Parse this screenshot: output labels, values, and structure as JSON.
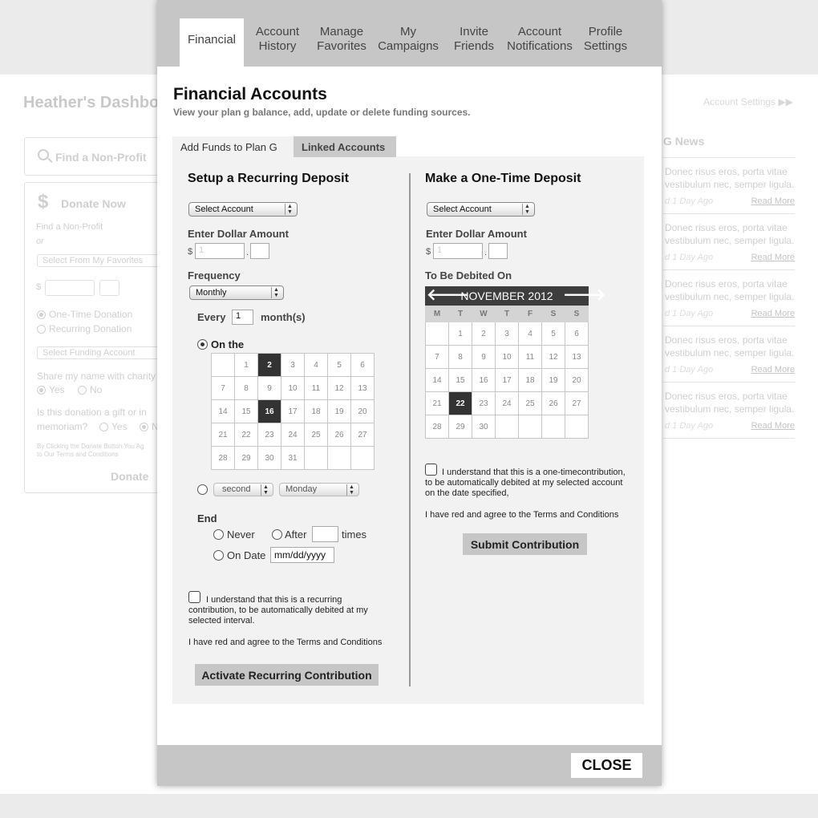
{
  "background": {
    "dashboard_title": "Heather's Dashbo",
    "find_nonprofit": "Find a Non-Profit",
    "donate_now": "Donate Now",
    "find_nonprofit_link": "Find a Non-Profit",
    "or": "or",
    "select_favorites": "Select From My Favorites",
    "dollar_sign": "$",
    "one_time_donation": "One-Time Donation",
    "recurring_donation": "Recurring Donation",
    "select_funding": "Select Funding Account",
    "share_name": "Share my name with charity",
    "yes": "Yes",
    "no": "No",
    "gift_question_1": "Is this donation a gift or in",
    "gift_question_2": "memoriam?",
    "gift_yes": "Yes",
    "gift_n": "N",
    "fine_print_1": "By Clicking the Donate Button You Ag",
    "fine_print_2": "to Our Terms and Conditions",
    "donate_button": "Donate",
    "account_settings": "Account Settings",
    "news_title": "G News",
    "news_items": [
      {
        "text": "Donec risus eros, porta vitae vestibulum nec, semper ligula.",
        "meta": "d 1 Day Ago",
        "read_more": "Read More"
      },
      {
        "text": "Donec risus eros, porta vitae vestibulum nec, semper ligula.",
        "meta": "d 1 Day Ago",
        "read_more": "Read More"
      },
      {
        "text": "Donec risus eros, porta vitae vestibulum nec, semper ligula.",
        "meta": "d 1 Day Ago",
        "read_more": "Read More"
      },
      {
        "text": "Donec risus eros, porta vitae vestibulum nec, semper ligula.",
        "meta": "d 1 Day Ago",
        "read_more": "Read More"
      },
      {
        "text": "Donec risus eros, porta vitae vestibulum nec, semper ligula.",
        "meta": "d 1 Day Ago",
        "read_more": "Read More"
      }
    ]
  },
  "modal": {
    "tabs": [
      {
        "line1": "Financial",
        "line2": ""
      },
      {
        "line1": "Account",
        "line2": "History"
      },
      {
        "line1": "Manage",
        "line2": "Favorites"
      },
      {
        "line1": "My",
        "line2": "Campaigns"
      },
      {
        "line1": "Invite",
        "line2": "Friends"
      },
      {
        "line1": "Account",
        "line2": "Notifications"
      },
      {
        "line1": "Profile",
        "line2": "Settings"
      }
    ],
    "title": "Financial Accounts",
    "subtitle": "View your plan g balance, add, update or delete funding sources.",
    "subtabs": [
      "Add Funds to Plan G",
      "Linked Accounts"
    ],
    "close": "CLOSE"
  },
  "recurring": {
    "heading": "Setup a Recurring Deposit",
    "select_account": "Select Account",
    "enter_amount": "Enter Dollar Amount",
    "dollar_sign": "$",
    "decimal": ".",
    "amount_placeholder": "1",
    "frequency_label": "Frequency",
    "frequency_value": "Monthly",
    "every": "Every",
    "every_value": "1",
    "months": "month(s)",
    "on_the": "On the",
    "day_grid": [
      [
        "",
        "1",
        "2",
        "3",
        "4",
        "5",
        "6"
      ],
      [
        "7",
        "8",
        "9",
        "10",
        "11",
        "12",
        "13"
      ],
      [
        "14",
        "15",
        "16",
        "17",
        "18",
        "19",
        "20"
      ],
      [
        "21",
        "22",
        "23",
        "24",
        "25",
        "26",
        "27"
      ],
      [
        "28",
        "29",
        "30",
        "31",
        "",
        "",
        ""
      ]
    ],
    "selected_days": [
      "2",
      "16"
    ],
    "ordinal_value": "second",
    "weekday_value": "Monday",
    "end_label": "End",
    "never": "Never",
    "after": "After",
    "times": "times",
    "on_date": "On Date",
    "date_placeholder": "mm/dd/yyyy",
    "agree_1": "I understand that this is a recurring",
    "agree_2": "contribution, to be automatically debited at my",
    "agree_3": "selected interval.",
    "terms": "I have red and agree to the Terms and Conditions",
    "button": "Activate Recurring Contribution"
  },
  "one_time": {
    "heading": "Make a One-Time Deposit",
    "select_account": "Select Account",
    "enter_amount": "Enter Dollar Amount",
    "dollar_sign": "$",
    "decimal": ".",
    "amount_placeholder": "1",
    "debit_label": "To Be Debited On",
    "calendar_month": "NOVEMBER 2012",
    "prev_arrow": "🡐",
    "next_arrow": "🡒",
    "weekdays": [
      "M",
      "T",
      "W",
      "T",
      "F",
      "S",
      "S"
    ],
    "weeks": [
      [
        "",
        "1",
        "2",
        "3",
        "4",
        "5",
        "6"
      ],
      [
        "7",
        "8",
        "9",
        "10",
        "11",
        "12",
        "13"
      ],
      [
        "14",
        "15",
        "16",
        "17",
        "18",
        "19",
        "20"
      ],
      [
        "21",
        "22",
        "23",
        "24",
        "25",
        "26",
        "27"
      ],
      [
        "28",
        "29",
        "30",
        "",
        "",
        "",
        ""
      ]
    ],
    "selected_day": "22",
    "agree_1": "I understand that this is a one-timecontribution,",
    "agree_2": "to be automatically debited at my selected account",
    "agree_3": "on the date specified,",
    "terms": "I have red and agree to the Terms and Conditions",
    "button": "Submit Contribution"
  }
}
